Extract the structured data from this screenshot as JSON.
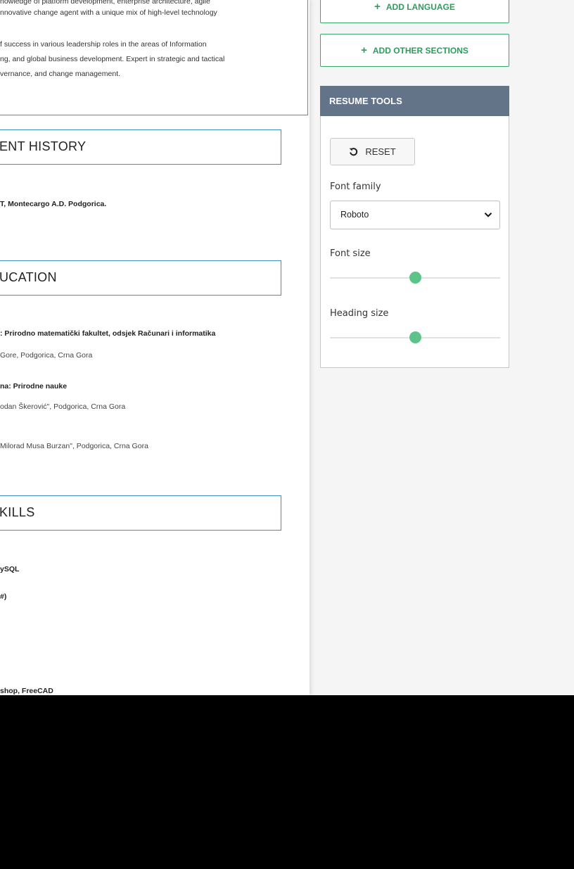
{
  "summary": {
    "lines": [
      "nowledge of platform development, enterprise architecture, agile",
      "nnovative change agent with a unique mix of high-level technology",
      "f success in various leadership roles in the areas of Information",
      "ng, and global business development. Expert in strategic and tactical",
      "vernance, and change management."
    ]
  },
  "employment": {
    "heading": "ENT HISTORY",
    "entry": "T, Montecargo A.D. Podgorica."
  },
  "education": {
    "heading": "UCATION",
    "entries": [
      "Prirodno matematički fakultet, odsjek Računari i informatika",
      "Gore, Podgorica, Crna Gora",
      "na: Prirodne nauke",
      "odan Škerović\", Podgorica, Crna Gora",
      "Milorad Musa Burzan\", Podgorica, Crna Gora"
    ]
  },
  "skills": {
    "heading": "KILLS",
    "entries": [
      "ySQL",
      "#)",
      "shop, FreeCAD"
    ]
  },
  "actions": {
    "add_language": "ADD LANGUAGE",
    "add_other_sections": "ADD OTHER SECTIONS"
  },
  "tools": {
    "title": "RESUME TOOLS",
    "reset_label": "RESET",
    "font_family_label": "Font family",
    "font_family_value": "Roboto",
    "font_size_label": "Font size",
    "font_size_level": 0.5,
    "heading_size_label": "Heading size",
    "heading_size_level": 0.5
  },
  "colors": {
    "accent_green": "#3aa76d",
    "section_border_blue": "#3b8fc9",
    "tools_header": "#637388",
    "slider_thumb": "#5cc48a"
  }
}
